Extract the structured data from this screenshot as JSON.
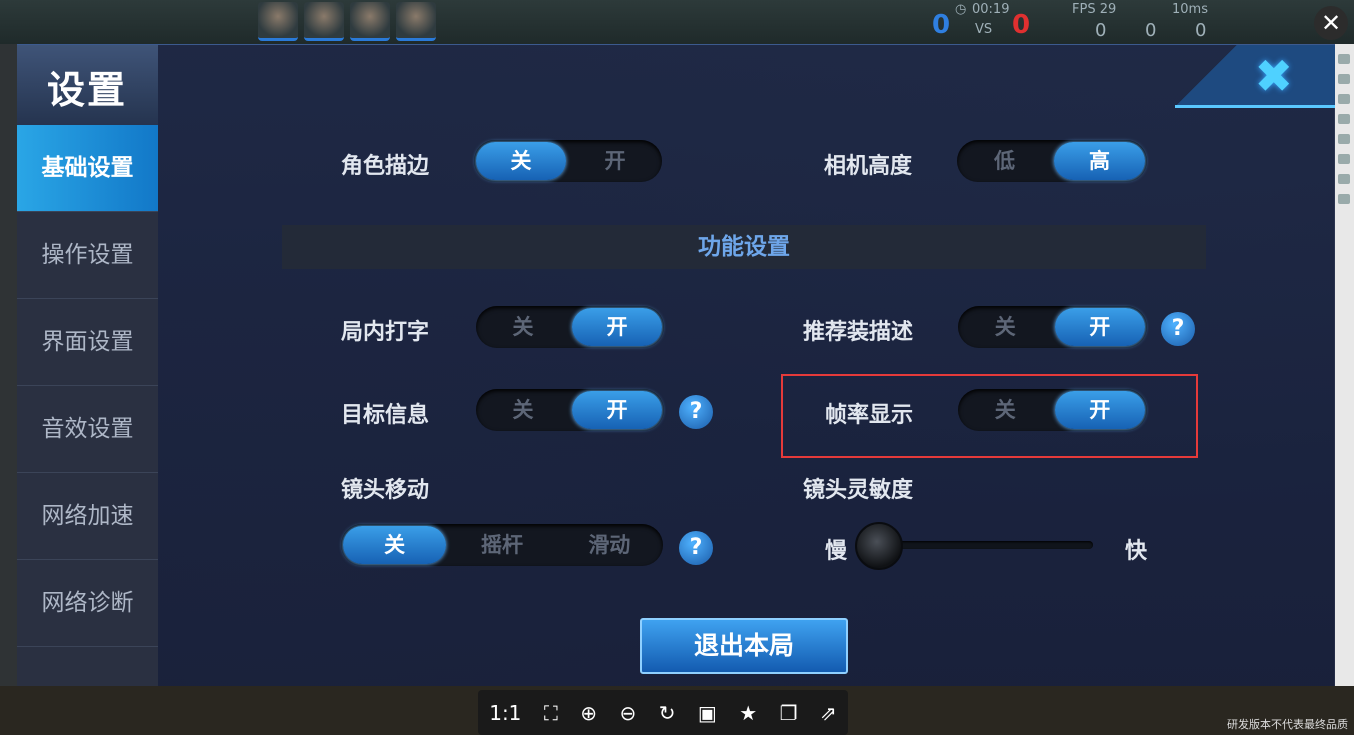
{
  "hud": {
    "time": "00:19",
    "fps": "FPS 29",
    "ping": "10ms",
    "score_left": "0",
    "score_vs": "VS",
    "score_right": "0",
    "kills": "0",
    "deaths": "0",
    "assists": "0"
  },
  "dialog": {
    "title": "设置",
    "close_symbol": "✖"
  },
  "sidebar": {
    "items": [
      {
        "label": "基础设置",
        "active": true
      },
      {
        "label": "操作设置"
      },
      {
        "label": "界面设置"
      },
      {
        "label": "音效设置"
      },
      {
        "label": "网络加速"
      },
      {
        "label": "网络诊断"
      }
    ]
  },
  "settings": {
    "outline": {
      "label": "角色描边",
      "off": "关",
      "on": "开",
      "selected": "off"
    },
    "camera_height": {
      "label": "相机高度",
      "low": "低",
      "high": "高",
      "selected": "high"
    },
    "section_title": "功能设置",
    "in_game_typing": {
      "label": "局内打字",
      "off": "关",
      "on": "开",
      "selected": "on"
    },
    "recommend_desc": {
      "label": "推荐装描述",
      "off": "关",
      "on": "开",
      "selected": "on"
    },
    "target_info": {
      "label": "目标信息",
      "off": "关",
      "on": "开",
      "selected": "on"
    },
    "fps_display": {
      "label": "帧率显示",
      "off": "关",
      "on": "开",
      "selected": "on"
    },
    "camera_move": {
      "label": "镜头移动",
      "off": "关",
      "joystick": "摇杆",
      "slide": "滑动",
      "selected": "off"
    },
    "camera_sensitivity": {
      "label": "镜头灵敏度",
      "slow": "慢",
      "fast": "快",
      "value": 0.0
    },
    "help_symbol": "?",
    "exit_label": "退出本局"
  },
  "viewer": {
    "zoom_label": "1:1",
    "watermark": "研发版本不代表最终品质",
    "window_close": "✕"
  }
}
